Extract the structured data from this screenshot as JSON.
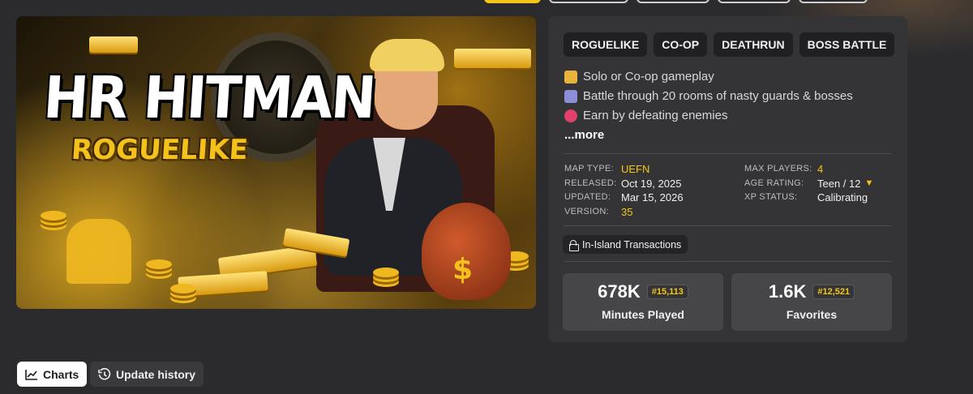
{
  "colors": {
    "background": "#2b2b2e",
    "panel": "#343437",
    "accent": "#f5c518",
    "stat_card": "#464649"
  },
  "hero": {
    "title_line1": "HR HITMAN",
    "title_line2": "ROGUELIKE"
  },
  "tags": [
    "ROGUELIKE",
    "CO-OP",
    "DEATHRUN",
    "BOSS BATTLE"
  ],
  "description": {
    "lines": [
      {
        "icon": "handshake-icon",
        "text": "Solo or Co-op gameplay"
      },
      {
        "icon": "robot-icon",
        "text": "Battle through 20 rooms of nasty guards & bosses"
      },
      {
        "icon": "sparkle-icon",
        "text": "Earn by defeating enemies"
      }
    ],
    "more_label": "...more"
  },
  "meta": {
    "map_type_label": "MAP TYPE:",
    "map_type": "UEFN",
    "released_label": "RELEASED:",
    "released": "Oct 19, 2025",
    "updated_label": "UPDATED:",
    "updated": "Mar 15, 2026",
    "version_label": "VERSION:",
    "version": "35",
    "max_players_label": "MAX PLAYERS:",
    "max_players": "4",
    "age_rating_label": "AGE RATING:",
    "age_rating": "Teen / 12",
    "xp_status_label": "XP STATUS:",
    "xp_status": "Calibrating"
  },
  "transactions_label": "In-Island Transactions",
  "stats": {
    "minutes": {
      "value": "678K",
      "rank": "#15,113",
      "label": "Minutes Played"
    },
    "favorites": {
      "value": "1.6K",
      "rank": "#12,521",
      "label": "Favorites"
    }
  },
  "tabs": {
    "charts": {
      "label": "Charts",
      "icon": "chart-line-icon"
    },
    "update_history": {
      "label": "Update history",
      "icon": "history-icon"
    }
  }
}
